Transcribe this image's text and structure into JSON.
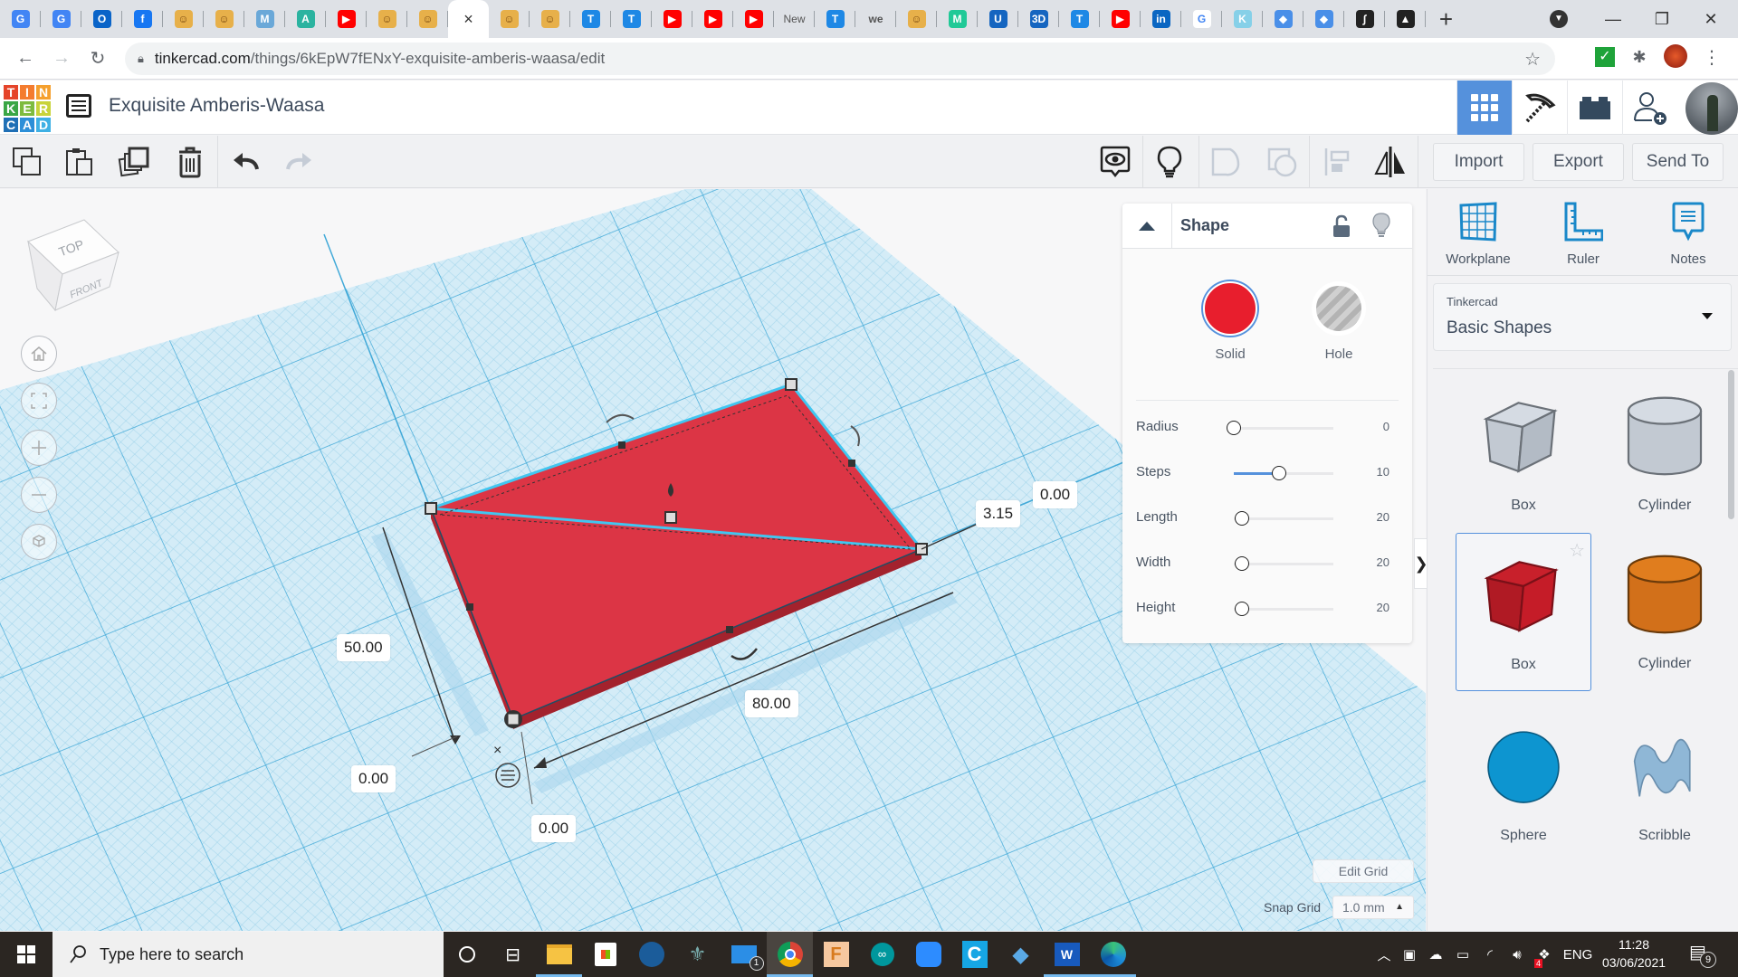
{
  "browser": {
    "tabs": [
      {
        "icon": "google-translate-icon",
        "color": "#4285f4",
        "glyph": "G"
      },
      {
        "icon": "google-translate-icon",
        "color": "#4285f4",
        "glyph": "G"
      },
      {
        "icon": "outlook-icon",
        "color": "#0a64c8",
        "glyph": "O"
      },
      {
        "icon": "facebook-icon",
        "color": "#1877f2",
        "glyph": "f"
      },
      {
        "icon": "robot-avatar-icon",
        "color": "#e7b04a",
        "glyph": "☺"
      },
      {
        "icon": "robot-avatar-icon",
        "color": "#e7b04a",
        "glyph": "☺"
      },
      {
        "icon": "shield-m-icon",
        "color": "#6aa8d8",
        "glyph": "M"
      },
      {
        "icon": "autodesk-icon",
        "color": "#2bb3a0",
        "glyph": "A"
      },
      {
        "icon": "youtube-icon",
        "color": "#ff0000",
        "glyph": "▶"
      },
      {
        "icon": "robot-avatar-icon",
        "color": "#e7b04a",
        "glyph": "☺"
      },
      {
        "icon": "robot-avatar-icon",
        "color": "#e7b04a",
        "glyph": "☺"
      },
      {
        "icon": "tinkercad-tab-icon",
        "color": "#ffffff",
        "glyph": "",
        "active": true,
        "close": "×"
      },
      {
        "icon": "robot-avatar-icon",
        "color": "#e7b04a",
        "glyph": "☺"
      },
      {
        "icon": "robot-avatar-icon",
        "color": "#e7b04a",
        "glyph": "☺"
      },
      {
        "icon": "t-circle-icon",
        "color": "#1e88e5",
        "glyph": "T"
      },
      {
        "icon": "t-circle-icon",
        "color": "#1e88e5",
        "glyph": "T"
      },
      {
        "icon": "youtube-icon",
        "color": "#ff0000",
        "glyph": "▶"
      },
      {
        "icon": "youtube-icon",
        "color": "#ff0000",
        "glyph": "▶"
      },
      {
        "icon": "youtube-icon",
        "color": "#ff0000",
        "glyph": "▶"
      },
      {
        "icon": "new-tab-text-icon",
        "color": "transparent",
        "glyph": "New",
        "text": true
      },
      {
        "icon": "t-circle-icon",
        "color": "#1e88e5",
        "glyph": "T"
      },
      {
        "icon": "we-icon",
        "color": "transparent",
        "glyph": "we",
        "text": true
      },
      {
        "icon": "robot-avatar-icon",
        "color": "#e7b04a",
        "glyph": "☺"
      },
      {
        "icon": "m-logo-icon",
        "color": "#20c997",
        "glyph": "M"
      },
      {
        "icon": "u-logo-icon",
        "color": "#1565c0",
        "glyph": "U"
      },
      {
        "icon": "3d-logo-icon",
        "color": "#1565c0",
        "glyph": "3D"
      },
      {
        "icon": "t-circle-icon",
        "color": "#1e88e5",
        "glyph": "T"
      },
      {
        "icon": "youtube-icon",
        "color": "#ff0000",
        "glyph": "▶"
      },
      {
        "icon": "linkedin-icon",
        "color": "#0a66c2",
        "glyph": "in"
      },
      {
        "icon": "google-icon",
        "color": "#ffffff",
        "glyph": "G"
      },
      {
        "icon": "kidbun-icon",
        "color": "#86d0e8",
        "glyph": "K"
      },
      {
        "icon": "graduation-cap-icon",
        "color": "#4a8fe8",
        "glyph": "◆"
      },
      {
        "icon": "graduation-cap-icon",
        "color": "#4a8fe8",
        "glyph": "◆"
      },
      {
        "icon": "integral-icon",
        "color": "#222222",
        "glyph": "∫"
      },
      {
        "icon": "inkscape-icon",
        "color": "#222222",
        "glyph": "▲"
      }
    ],
    "new_tab": "+",
    "url_host": "tinkercad.com",
    "url_path": "/things/6kEpW7fENxY-exquisite-amberis-waasa/edit"
  },
  "app": {
    "logo_letters": [
      "T",
      "I",
      "N",
      "K",
      "E",
      "R",
      "C",
      "A",
      "D"
    ],
    "logo_colors": [
      "#e5442a",
      "#f47c2f",
      "#f5a02e",
      "#3aa645",
      "#7dbb3f",
      "#c8d33a",
      "#1f6fb5",
      "#2c8fd8",
      "#3eb0e4"
    ],
    "design_title": "Exquisite Amberis-Waasa",
    "header_buttons": [
      "3d-design",
      "minecraft",
      "bricks",
      "add-user"
    ]
  },
  "toolbar": {
    "import": "Import",
    "export": "Export",
    "send_to": "Send To"
  },
  "viewcube": {
    "top": "TOP",
    "front": "FRONT"
  },
  "dimensions": {
    "width": "50.00",
    "length": "80.00",
    "height": "3.15",
    "elevation": "0.00",
    "pos_x": "0.00",
    "pos_y": "0.00"
  },
  "inspector": {
    "title": "Shape",
    "solid_label": "Solid",
    "hole_label": "Hole",
    "solid_color": "#e81e2d",
    "params": [
      {
        "label": "Radius",
        "value": "0",
        "fraction": 0.0
      },
      {
        "label": "Steps",
        "value": "10",
        "fraction": 0.45
      },
      {
        "label": "Length",
        "value": "20",
        "fraction": 0.08
      },
      {
        "label": "Width",
        "value": "20",
        "fraction": 0.08
      },
      {
        "label": "Height",
        "value": "20",
        "fraction": 0.08
      }
    ]
  },
  "right_panel": {
    "tools": [
      "Workplane",
      "Ruler",
      "Notes"
    ],
    "library_source": "Tinkercad",
    "library_name": "Basic Shapes",
    "shapes": [
      {
        "label": "Box",
        "kind": "box-hole"
      },
      {
        "label": "Cylinder",
        "kind": "cylinder-hole"
      },
      {
        "label": "Box",
        "kind": "box",
        "selected": true
      },
      {
        "label": "Cylinder",
        "kind": "cylinder"
      },
      {
        "label": "Sphere",
        "kind": "sphere"
      },
      {
        "label": "Scribble",
        "kind": "scribble"
      }
    ]
  },
  "grid": {
    "edit_grid": "Edit Grid",
    "snap_label": "Snap Grid",
    "snap_value": "1.0 mm"
  },
  "taskbar": {
    "search_placeholder": "Type here to search",
    "mail_badge": "1",
    "dropbox_badge": "4",
    "language": "ENG",
    "time": "11:28",
    "date": "03/06/2021",
    "notification_count": "9"
  }
}
